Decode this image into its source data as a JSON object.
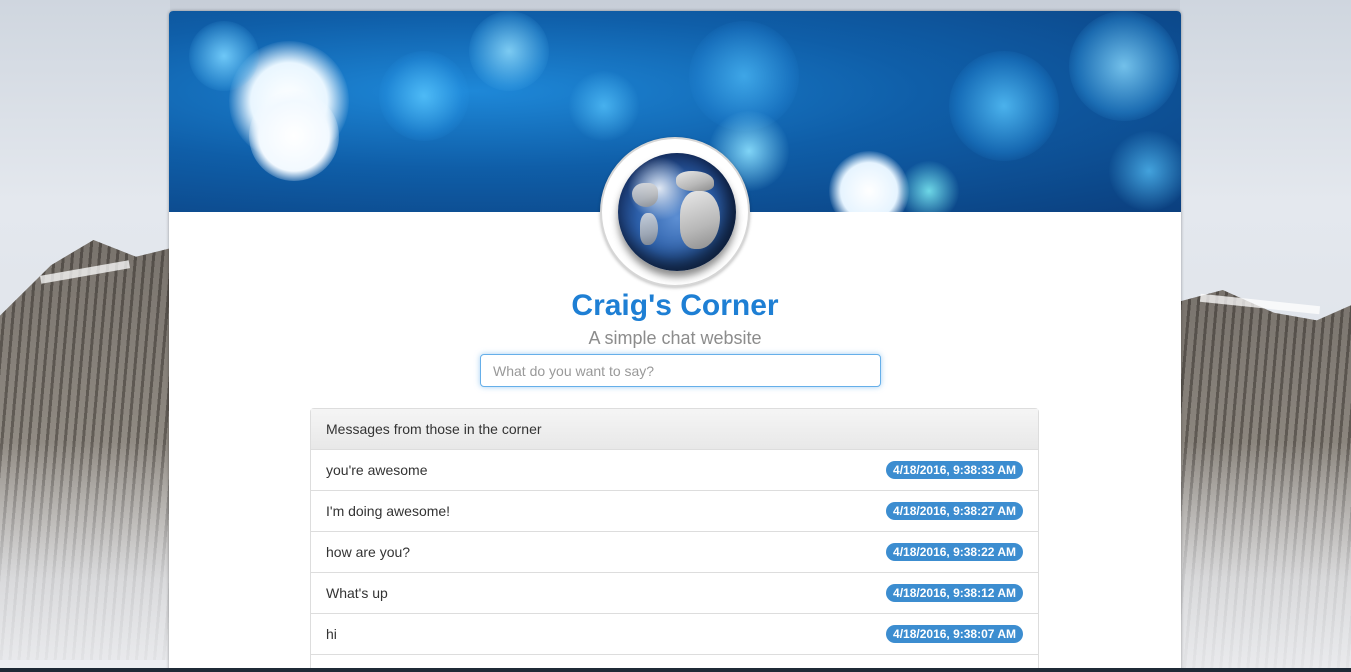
{
  "site": {
    "title": "Craig's Corner",
    "subtitle": "A simple chat website"
  },
  "composer": {
    "placeholder": "What do you want to say?"
  },
  "messages_panel": {
    "heading": "Messages from those in the corner",
    "items": [
      {
        "text": "you're awesome",
        "time": "4/18/2016, 9:38:33 AM"
      },
      {
        "text": "I'm doing awesome!",
        "time": "4/18/2016, 9:38:27 AM"
      },
      {
        "text": "how are you?",
        "time": "4/18/2016, 9:38:22 AM"
      },
      {
        "text": "What's up",
        "time": "4/18/2016, 9:38:12 AM"
      },
      {
        "text": "hi",
        "time": "4/18/2016, 9:38:07 AM"
      }
    ]
  },
  "colors": {
    "title": "#1e7fd4",
    "badge": "#3c8dd0",
    "banner": "#0f5ea8"
  },
  "icons": {
    "logo": "globe-icon"
  }
}
